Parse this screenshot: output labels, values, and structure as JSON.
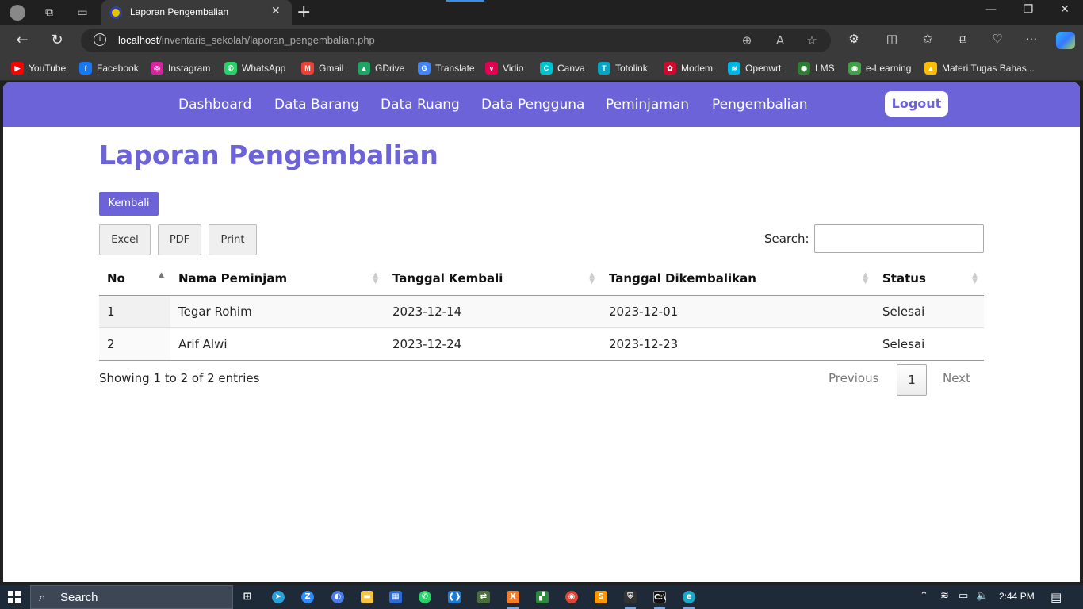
{
  "browser": {
    "tab_title": "Laporan Pengembalian",
    "url_host": "localhost",
    "url_path": "/inventaris_sekolah/laporan_pengembalian.php",
    "bookmarks": [
      {
        "label": "YouTube",
        "color": "#ff0000",
        "glyph": "▶"
      },
      {
        "label": "Facebook",
        "color": "#1877f2",
        "glyph": "f"
      },
      {
        "label": "Instagram",
        "color": "#d6249f",
        "glyph": "◎"
      },
      {
        "label": "WhatsApp",
        "color": "#25d366",
        "glyph": "✆"
      },
      {
        "label": "Gmail",
        "color": "#ea4335",
        "glyph": "M"
      },
      {
        "label": "GDrive",
        "color": "#1fa463",
        "glyph": "▲"
      },
      {
        "label": "Translate",
        "color": "#4285f4",
        "glyph": "G"
      },
      {
        "label": "Vidio",
        "color": "#e5004f",
        "glyph": "v"
      },
      {
        "label": "Canva",
        "color": "#00c4cc",
        "glyph": "C"
      },
      {
        "label": "Totolink",
        "color": "#0aa3c2",
        "glyph": "T"
      },
      {
        "label": "Modem",
        "color": "#cf0a2c",
        "glyph": "✿"
      },
      {
        "label": "Openwrt",
        "color": "#00b5e2",
        "glyph": "≋"
      },
      {
        "label": "LMS",
        "color": "#2e7d32",
        "glyph": "◉"
      },
      {
        "label": "e-Learning",
        "color": "#43a047",
        "glyph": "◉"
      },
      {
        "label": "Materi Tugas Bahas...",
        "color": "#fbbc04",
        "glyph": "▲"
      }
    ]
  },
  "app": {
    "nav": [
      "Dashboard",
      "Data Barang",
      "Data Ruang",
      "Data Pengguna",
      "Peminjaman",
      "Pengembalian"
    ],
    "logout_label": "Logout",
    "page_title": "Laporan Pengembalian",
    "back_label": "Kembali",
    "export_buttons": [
      "Excel",
      "PDF",
      "Print"
    ],
    "search_label": "Search:",
    "search_value": ""
  },
  "table": {
    "columns": [
      "No",
      "Nama Peminjam",
      "Tanggal Kembali",
      "Tanggal Dikembalikan",
      "Status"
    ],
    "sorted_column": "No",
    "rows": [
      [
        "1",
        "Tegar Rohim",
        "2023-12-14",
        "2023-12-01",
        "Selesai"
      ],
      [
        "2",
        "Arif Alwi",
        "2023-12-24",
        "2023-12-23",
        "Selesai"
      ]
    ],
    "info": "Showing 1 to 2 of 2 entries",
    "pagination": {
      "previous": "Previous",
      "current": "1",
      "next": "Next"
    }
  },
  "taskbar": {
    "search_placeholder": "Search",
    "time": "2:44 PM"
  },
  "colors": {
    "accent": "#6c63d9"
  }
}
